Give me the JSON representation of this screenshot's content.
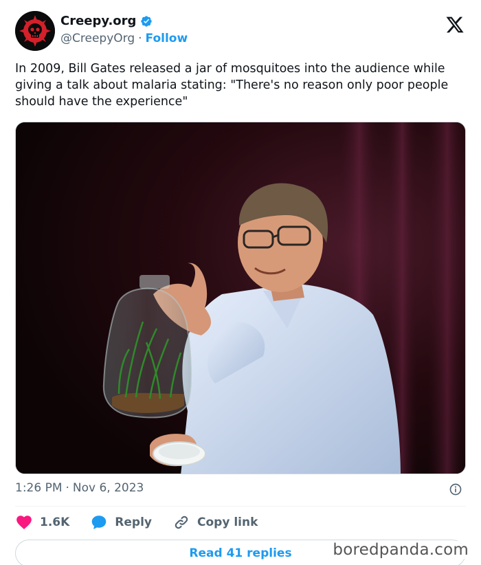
{
  "account": {
    "display_name": "Creepy.org",
    "handle": "@CreepyOrg",
    "separator": "·",
    "follow_label": "Follow",
    "verified": true
  },
  "tweet": {
    "text": "In 2009, Bill Gates released a jar of mosquitoes into the audience while giving a talk about malaria stating: \"There's no reason only poor people should have the experience\"",
    "time": "1:26 PM",
    "separator": "·",
    "date": "Nov 6, 2023"
  },
  "actions": {
    "likes": "1.6K",
    "reply_label": "Reply",
    "copy_link_label": "Copy link"
  },
  "read_replies_label": "Read 41 replies",
  "watermark": "boredpanda.com",
  "icons": {
    "brand": "x-logo-icon",
    "verified": "verified-badge-icon",
    "info": "info-icon",
    "like": "heart-icon",
    "reply": "speech-bubble-icon",
    "copy": "link-icon"
  },
  "colors": {
    "accent": "#1d9bf0",
    "like": "#f91880",
    "muted": "#536471",
    "text": "#0f1419"
  }
}
